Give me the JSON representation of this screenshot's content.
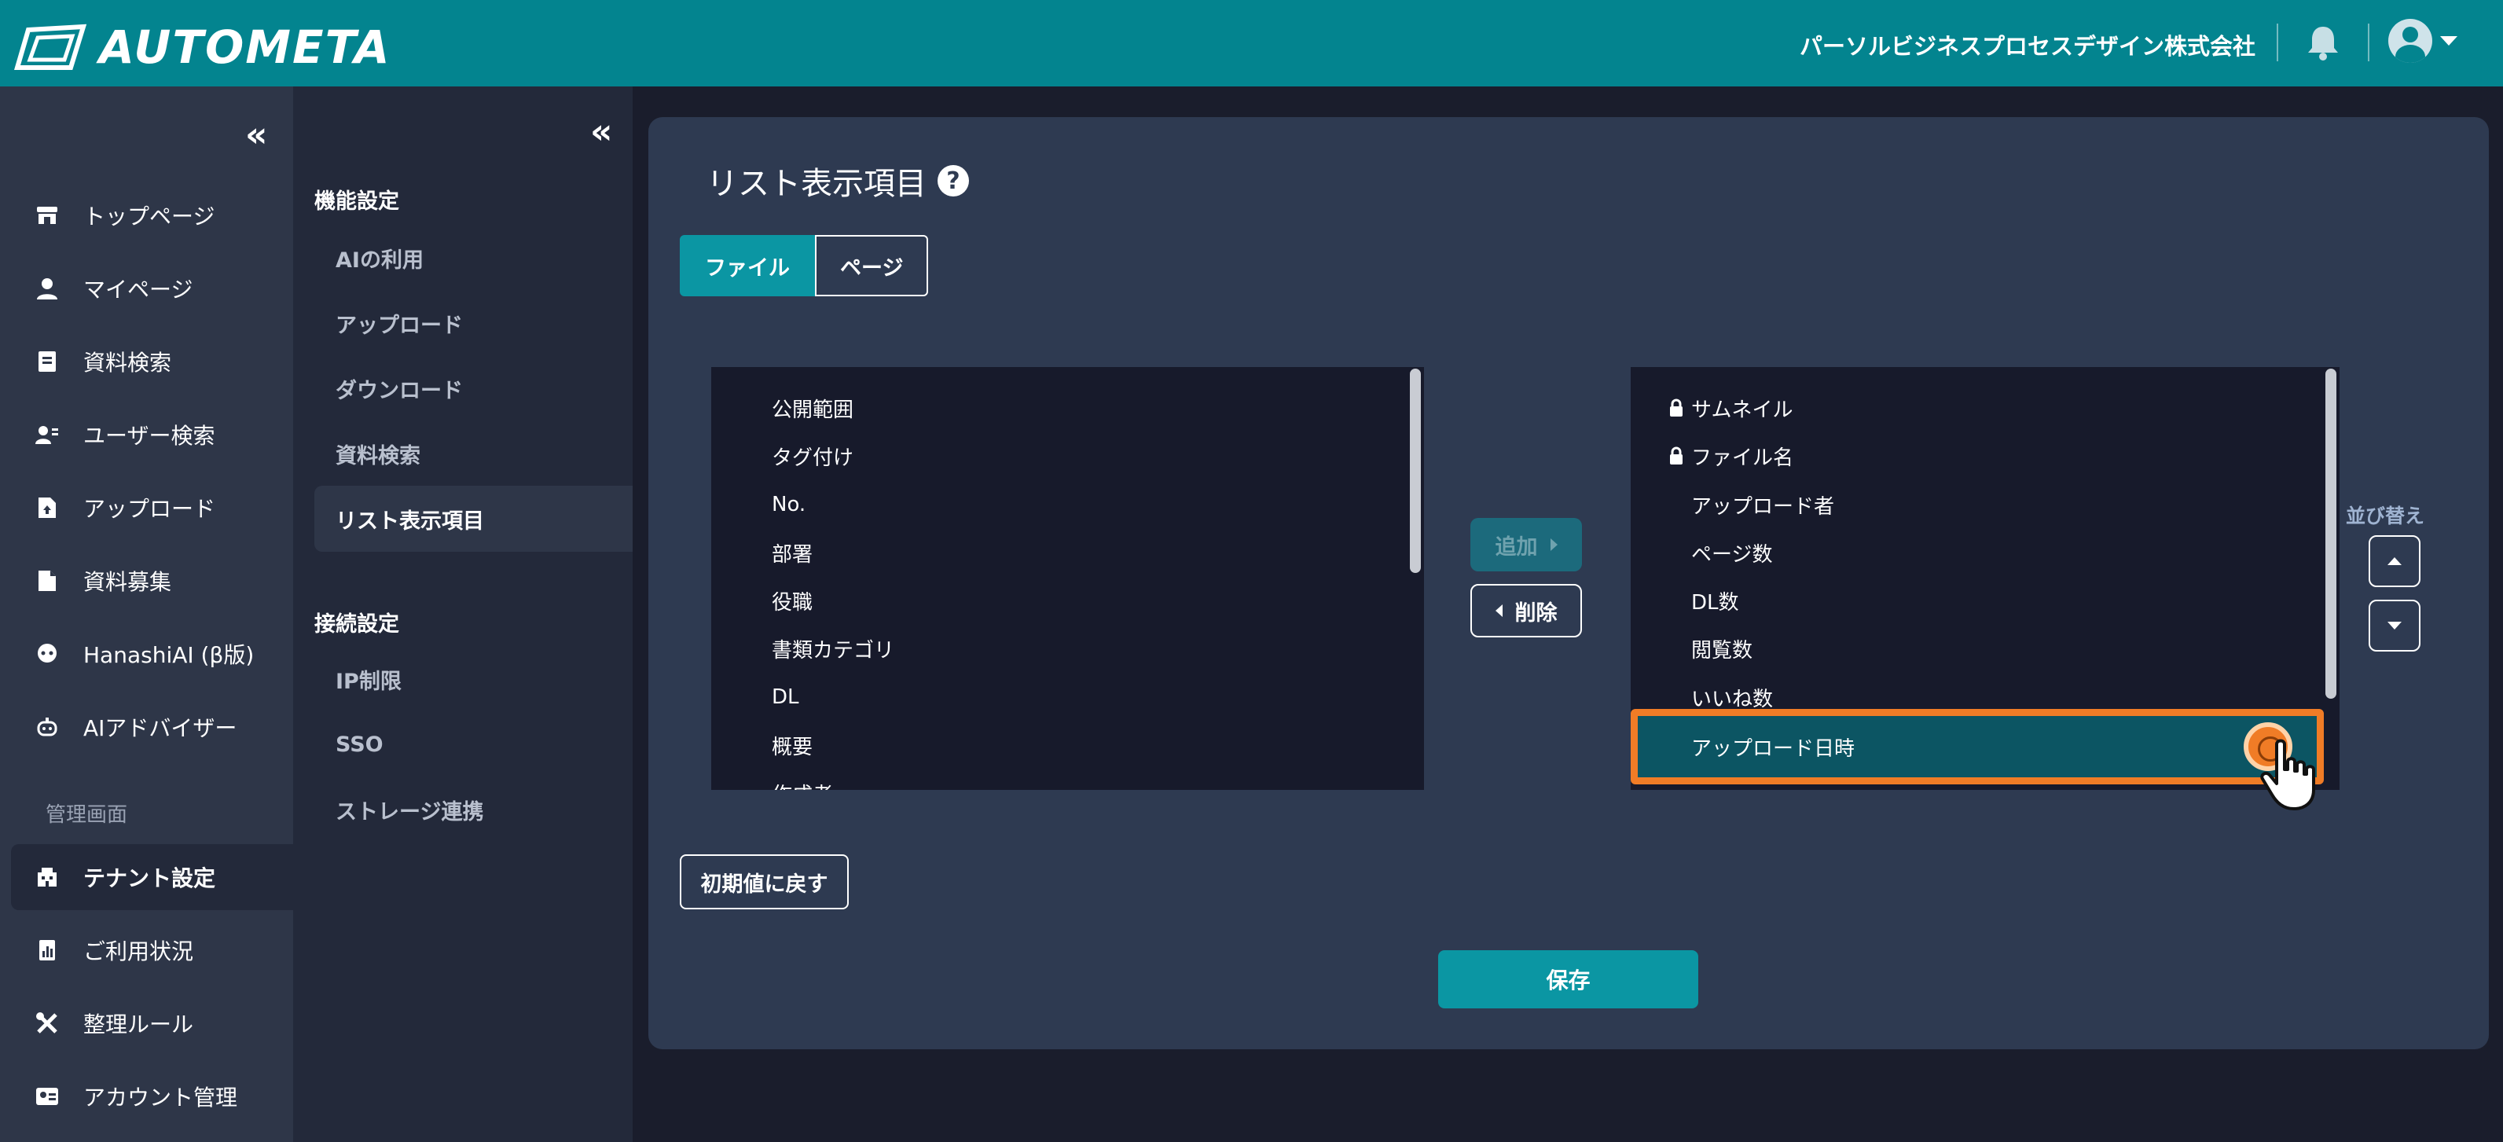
{
  "header": {
    "logo_text": "AUTOMETA",
    "company": "パーソルビジネスプロセスデザイン株式会社"
  },
  "sidebar": {
    "items": [
      {
        "label": "トップページ",
        "icon": "store-icon"
      },
      {
        "label": "マイページ",
        "icon": "person-icon"
      },
      {
        "label": "資料検索",
        "icon": "document-search-icon"
      },
      {
        "label": "ユーザー検索",
        "icon": "user-search-icon"
      },
      {
        "label": "アップロード",
        "icon": "upload-file-icon"
      },
      {
        "label": "資料募集",
        "icon": "file-icon"
      },
      {
        "label": "HanashiAI (β版)",
        "icon": "chat-bot-icon"
      },
      {
        "label": "AIアドバイザー",
        "icon": "robot-icon"
      }
    ],
    "admin_section": "管理画面",
    "admin_items": [
      {
        "label": "テナント設定",
        "icon": "building-icon",
        "active": true
      },
      {
        "label": "ご利用状況",
        "icon": "chart-icon"
      },
      {
        "label": "整理ルール",
        "icon": "tools-icon"
      },
      {
        "label": "アカウント管理",
        "icon": "id-card-icon"
      }
    ]
  },
  "subnav": {
    "section1": "機能設定",
    "items1": [
      "AIの利用",
      "アップロード",
      "ダウンロード",
      "資料検索",
      "リスト表示項目"
    ],
    "active": "リスト表示項目",
    "section2": "接続設定",
    "items2": [
      "IP制限",
      "SSO",
      "ストレージ連携"
    ]
  },
  "main": {
    "title": "リスト表示項目",
    "help": "?",
    "tabs": [
      "ファイル",
      "ページ"
    ],
    "available": [
      "公開範囲",
      "タグ付け",
      "No.",
      "部署",
      "役職",
      "書類カテゴリ",
      "DL",
      "概要",
      "作成者"
    ],
    "selected": [
      {
        "label": "サムネイル",
        "locked": true
      },
      {
        "label": "ファイル名",
        "locked": true
      },
      {
        "label": "アップロード者",
        "locked": false
      },
      {
        "label": "ページ数",
        "locked": false
      },
      {
        "label": "DL数",
        "locked": false
      },
      {
        "label": "閲覧数",
        "locked": false
      },
      {
        "label": "いいね数",
        "locked": false
      }
    ],
    "highlighted": "アップロード日時",
    "add_button": "追加",
    "delete_button": "削除",
    "sort_label": "並び替え",
    "reset_button": "初期値に戻す",
    "save_button": "保存"
  },
  "colors": {
    "header": "#03848f",
    "accent": "#0b96a3",
    "highlight_border": "#f07c26"
  }
}
